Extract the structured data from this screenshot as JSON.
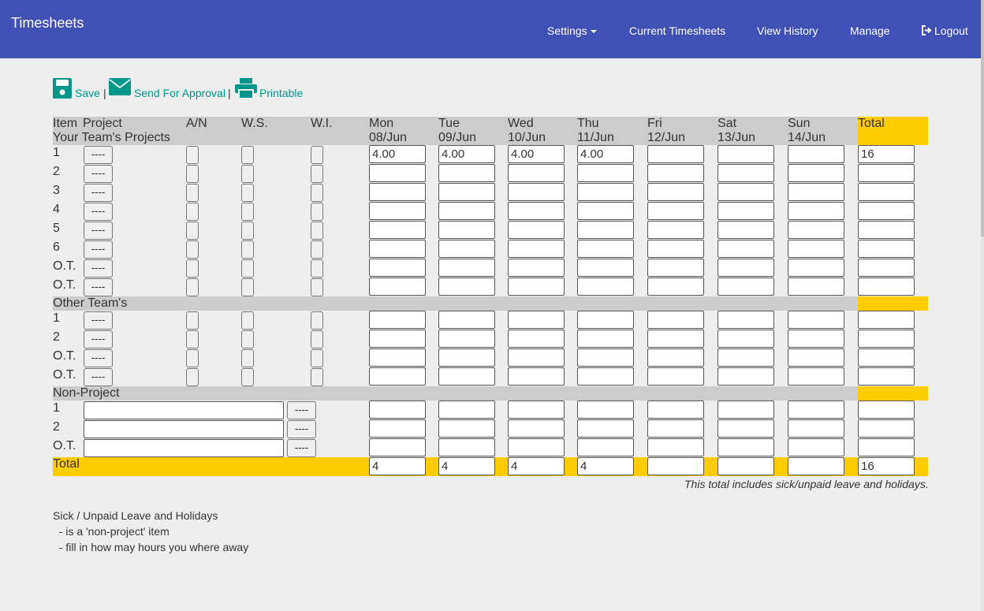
{
  "app": {
    "title": "Timesheets"
  },
  "nav": [
    {
      "label": "Settings",
      "has_caret": true
    },
    {
      "label": "Current Timesheets"
    },
    {
      "label": "View History"
    },
    {
      "label": "Manage"
    },
    {
      "label": "Logout",
      "icon": "logout-icon"
    }
  ],
  "toolbar": {
    "save_label": "Save",
    "approval_label": "Send For Approval",
    "printable_label": "Printable",
    "separator": "|"
  },
  "table": {
    "headers": {
      "item": "Item",
      "project": "Project",
      "an": "A/N",
      "ws": "W.S.",
      "wi": "W.I.",
      "total": "Total",
      "days": [
        {
          "day": "Mon",
          "date": "08/Jun"
        },
        {
          "day": "Tue",
          "date": "09/Jun"
        },
        {
          "day": "Wed",
          "date": "10/Jun"
        },
        {
          "day": "Thu",
          "date": "11/Jun"
        },
        {
          "day": "Fri",
          "date": "12/Jun"
        },
        {
          "day": "Sat",
          "date": "13/Jun"
        },
        {
          "day": "Sun",
          "date": "14/Jun"
        }
      ]
    },
    "sections": [
      {
        "title": "Your Team's Projects",
        "kind": "project",
        "rows": [
          {
            "item": "1",
            "project_btn": "----",
            "hours": [
              "4.00",
              "4.00",
              "4.00",
              "4.00",
              "",
              "",
              ""
            ],
            "total": "16"
          },
          {
            "item": "2",
            "project_btn": "----",
            "hours": [
              "",
              "",
              "",
              "",
              "",
              "",
              ""
            ],
            "total": ""
          },
          {
            "item": "3",
            "project_btn": "----",
            "hours": [
              "",
              "",
              "",
              "",
              "",
              "",
              ""
            ],
            "total": ""
          },
          {
            "item": "4",
            "project_btn": "----",
            "hours": [
              "",
              "",
              "",
              "",
              "",
              "",
              ""
            ],
            "total": ""
          },
          {
            "item": "5",
            "project_btn": "----",
            "hours": [
              "",
              "",
              "",
              "",
              "",
              "",
              ""
            ],
            "total": ""
          },
          {
            "item": "6",
            "project_btn": "----",
            "hours": [
              "",
              "",
              "",
              "",
              "",
              "",
              ""
            ],
            "total": ""
          },
          {
            "item": "O.T.",
            "project_btn": "----",
            "hours": [
              "",
              "",
              "",
              "",
              "",
              "",
              ""
            ],
            "total": ""
          },
          {
            "item": "O.T.",
            "project_btn": "----",
            "hours": [
              "",
              "",
              "",
              "",
              "",
              "",
              ""
            ],
            "total": ""
          }
        ]
      },
      {
        "title": "Other Team's",
        "kind": "project",
        "rows": [
          {
            "item": "1",
            "project_btn": "----",
            "hours": [
              "",
              "",
              "",
              "",
              "",
              "",
              ""
            ],
            "total": ""
          },
          {
            "item": "2",
            "project_btn": "----",
            "hours": [
              "",
              "",
              "",
              "",
              "",
              "",
              ""
            ],
            "total": ""
          },
          {
            "item": "O.T.",
            "project_btn": "----",
            "hours": [
              "",
              "",
              "",
              "",
              "",
              "",
              ""
            ],
            "total": ""
          },
          {
            "item": "O.T.",
            "project_btn": "----",
            "hours": [
              "",
              "",
              "",
              "",
              "",
              "",
              ""
            ],
            "total": ""
          }
        ]
      },
      {
        "title": "Non-Project",
        "kind": "nonproject",
        "rows": [
          {
            "item": "1",
            "description": "",
            "btn": "----",
            "hours": [
              "",
              "",
              "",
              "",
              "",
              "",
              ""
            ],
            "total": ""
          },
          {
            "item": "2",
            "description": "",
            "btn": "----",
            "hours": [
              "",
              "",
              "",
              "",
              "",
              "",
              ""
            ],
            "total": ""
          },
          {
            "item": "O.T.",
            "description": "",
            "btn": "----",
            "hours": [
              "",
              "",
              "",
              "",
              "",
              "",
              ""
            ],
            "total": ""
          }
        ]
      }
    ],
    "totals": {
      "label": "Total",
      "days": [
        "4",
        "4",
        "4",
        "4",
        "",
        "",
        ""
      ],
      "total": "16"
    },
    "note": "This total includes sick/unpaid leave and holidays."
  },
  "help": {
    "title": "Sick / Unpaid Leave and Holidays",
    "lines": [
      "  - is a 'non-project' item",
      "  - fill in how may hours you where away"
    ]
  },
  "colors": {
    "navbar": "#3f51b5",
    "accent": "#009688",
    "total_highlight": "#ffcc00",
    "band": "#cccccc"
  }
}
